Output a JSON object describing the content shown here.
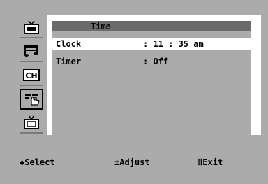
{
  "menu": {
    "title": "Time",
    "rows": [
      {
        "label": "Clock",
        "value": ": 11 : 35 am"
      },
      {
        "label": "Timer",
        "value": ": Off"
      }
    ]
  },
  "sidebar": {
    "icons": [
      "tv-picture-icon",
      "music-sound-icon",
      "channel-icon",
      "setup-hand-icon",
      "input-tv-icon"
    ]
  },
  "footer": {
    "select_glyph": "◆",
    "select_label": "Select",
    "adjust_glyph": "±",
    "adjust_label": "Adjust",
    "exit_glyph": "Ⅲ",
    "exit_label": "Exit"
  }
}
